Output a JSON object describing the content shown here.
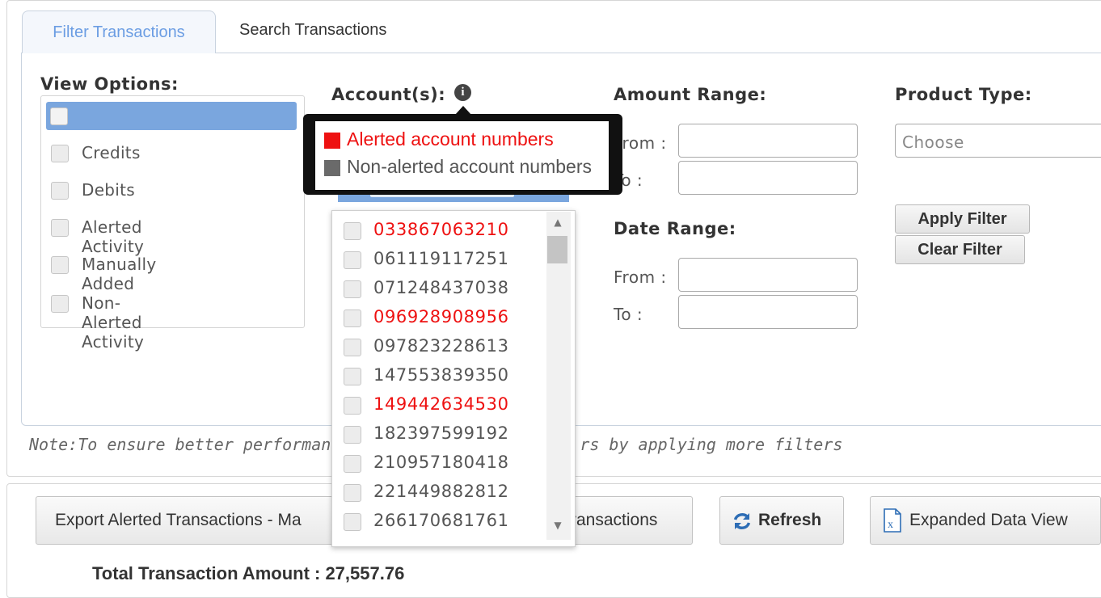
{
  "tabs": [
    {
      "label": "Filter Transactions",
      "active": true
    },
    {
      "label": "Search Transactions",
      "active": false
    }
  ],
  "view_options": {
    "label": "View Options:",
    "items": [
      "Credits",
      "Debits",
      "Alerted Activity",
      "Manually Added",
      "Non-Alerted Activity"
    ]
  },
  "accounts": {
    "label": "Account(s):",
    "info_icon": "info-icon",
    "legend": {
      "alerted": "Alerted account numbers",
      "non_alerted": "Non-alerted account numbers"
    },
    "items": [
      {
        "number": "033867063210",
        "alerted": true
      },
      {
        "number": "061119117251",
        "alerted": false
      },
      {
        "number": "071248437038",
        "alerted": false
      },
      {
        "number": "096928908956",
        "alerted": true
      },
      {
        "number": "097823228613",
        "alerted": false
      },
      {
        "number": "147553839350",
        "alerted": false
      },
      {
        "number": "149442634530",
        "alerted": true
      },
      {
        "number": "182397599192",
        "alerted": false
      },
      {
        "number": "210957180418",
        "alerted": false
      },
      {
        "number": "221449882812",
        "alerted": false
      },
      {
        "number": "266170681761",
        "alerted": false
      }
    ]
  },
  "amount_range": {
    "label": "Amount Range:",
    "from_label": "From :",
    "to_label": "To :"
  },
  "date_range": {
    "label": "Date Range:",
    "from_label": "From :",
    "to_label": "To :"
  },
  "product_type": {
    "label": "Product Type:",
    "placeholder": "Choose"
  },
  "buttons": {
    "apply": "Apply Filter",
    "clear": "Clear Filter",
    "export_left": "Export Alerted Transactions - Ma",
    "export_right": "ransactions",
    "refresh": "Refresh",
    "expanded": "Expanded Data View"
  },
  "note": {
    "left": "Note:To ensure better performanc",
    "right": "rs by applying more filters"
  },
  "total": "Total Transaction Amount : 27,557.76",
  "colors": {
    "alerted": "#ee1111",
    "non_alerted": "#555555",
    "active_tab": "#6b9de3",
    "selected_row": "#7aa6de"
  }
}
